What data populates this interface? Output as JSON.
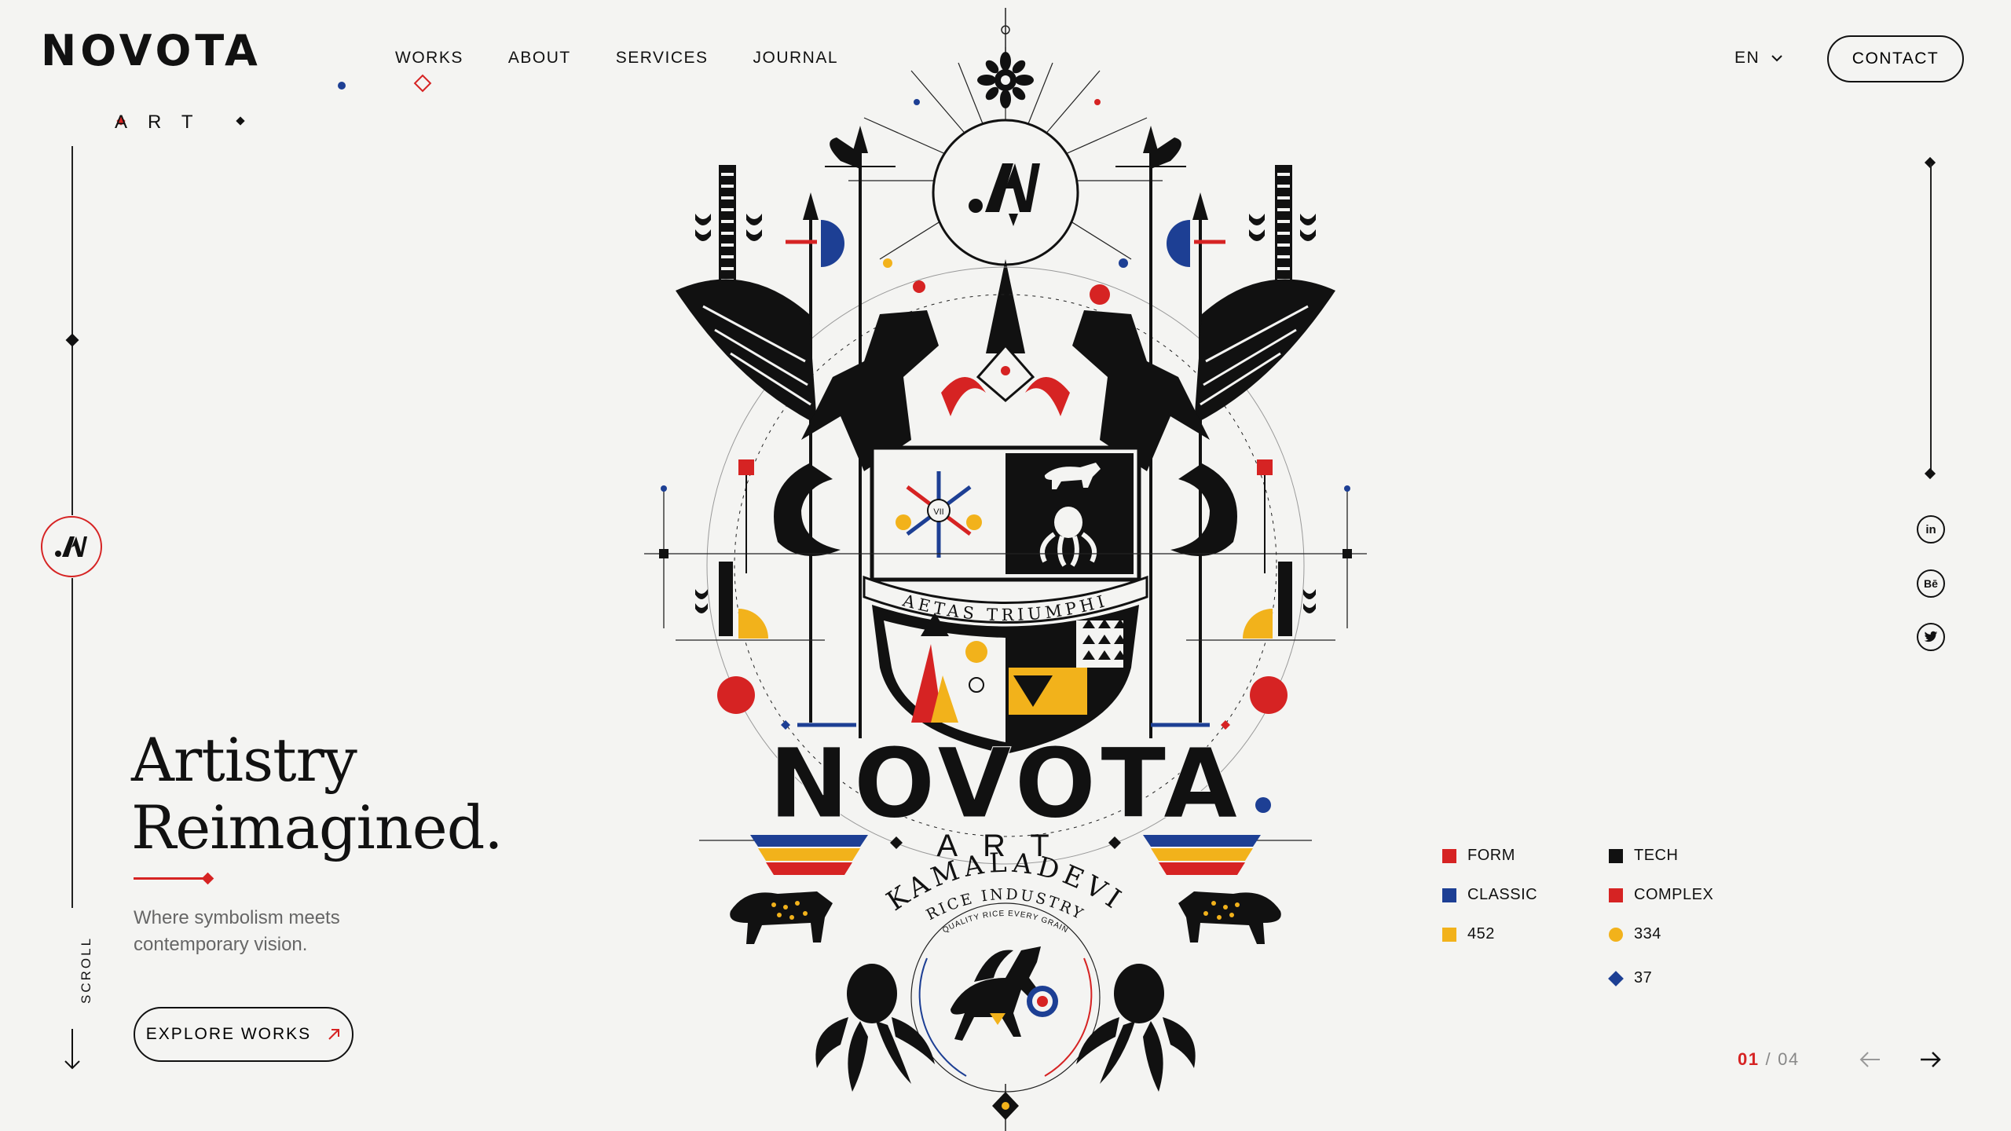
{
  "brand": {
    "name": "NOVOTA",
    "sub": "ART"
  },
  "nav": {
    "items": [
      {
        "label": "WORKS"
      },
      {
        "label": "ABOUT"
      },
      {
        "label": "SERVICES"
      },
      {
        "label": "JOURNAL"
      }
    ],
    "active": "WORKS"
  },
  "header": {
    "language": "EN",
    "contact_label": "CONTACT"
  },
  "left_rail": {
    "badge": ".AN",
    "scroll_label": "SCROLL"
  },
  "hero": {
    "title_line1": "Artistry",
    "title_line2": "Reimagined.",
    "subtitle_line1": "Where symbolism meets",
    "subtitle_line2": "contemporary vision.",
    "cta_label": "EXPLORE WORKS"
  },
  "crest": {
    "monogram": ".AN",
    "motto": "AETAS TRIUMPHI",
    "wordmark": "NOVOTA",
    "wordmark_sub": "ART",
    "arc_line1": "KAMALADEVI",
    "arc_line2": "RICE INDUSTRY",
    "arc_line3": "QUALITY RICE EVERY GRAIN",
    "shield_numeral": "VII"
  },
  "social": [
    {
      "name": "linkedin",
      "label": "in"
    },
    {
      "name": "behance",
      "label": "Bē"
    },
    {
      "name": "twitter",
      "label": "🐦"
    }
  ],
  "legend": {
    "col1": [
      {
        "label": "FORM",
        "color": "#d62323",
        "shape": "square"
      },
      {
        "label": "CLASSIC",
        "color": "#1d3f94",
        "shape": "square"
      },
      {
        "label": "452",
        "color": "#f2b21b",
        "shape": "square"
      }
    ],
    "col2": [
      {
        "label": "TECH",
        "color": "#111111",
        "shape": "square"
      },
      {
        "label": "COMPLEX",
        "color": "#d62323",
        "shape": "square"
      },
      {
        "label": "334",
        "color": "#f2b21b",
        "shape": "circle"
      },
      {
        "label": "37",
        "color": "#1d3f94",
        "shape": "diamond"
      }
    ]
  },
  "pager": {
    "current": "01",
    "separator": "/",
    "total": "04"
  },
  "colors": {
    "accent_red": "#d62323",
    "accent_blue": "#1d3f94",
    "accent_yellow": "#f2b21b",
    "ink": "#111111",
    "background": "#f4f4f2"
  }
}
